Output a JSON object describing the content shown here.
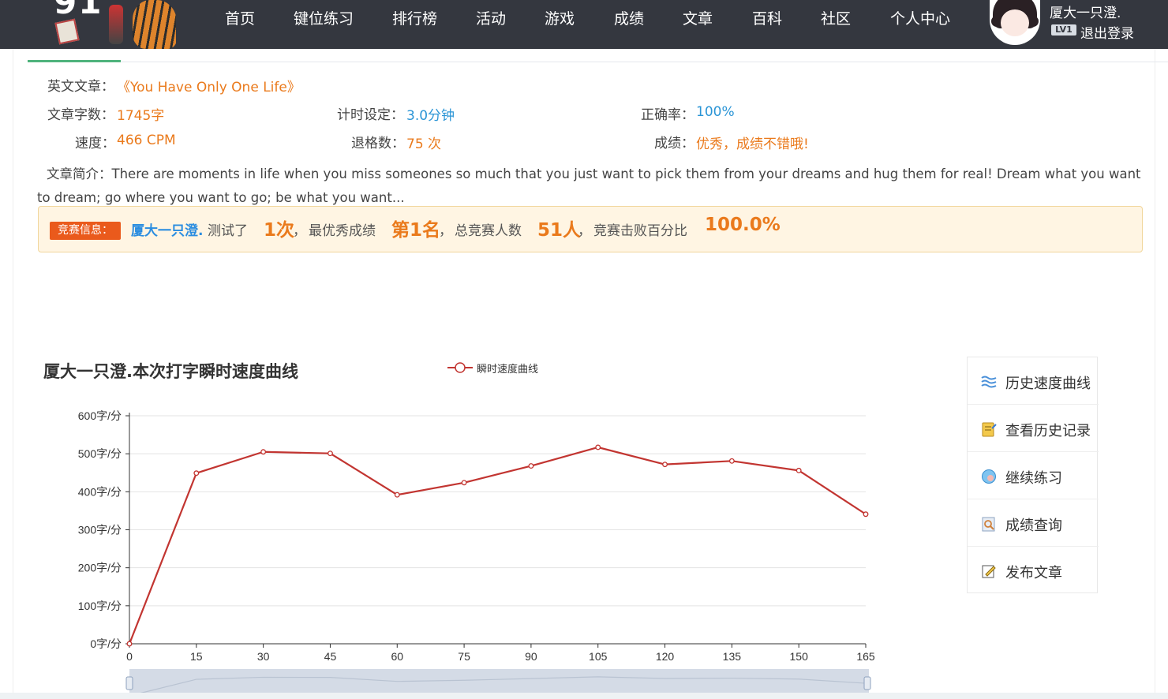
{
  "nav": {
    "links": [
      "首页",
      "键位练习",
      "排行榜",
      "活动",
      "游戏",
      "成绩",
      "文章",
      "百科",
      "社区",
      "个人中心"
    ],
    "user_name": "厦大一只澄.",
    "level": "LV1",
    "logout": "退出登录"
  },
  "result": {
    "article_label": "英文文章：",
    "article_title": "《You Have Only One Life》",
    "word_count_label": "文章字数：",
    "word_count": "1745字",
    "time_label": "计时设定：",
    "time_value": "3.0分钟",
    "accuracy_label": "正确率：",
    "accuracy": "100%",
    "speed_label": "速度：",
    "speed": "466 CPM",
    "backspace_label": "退格数：",
    "backspace": "75 次",
    "grade_label": "成绩：",
    "grade": "优秀，成绩不错哦!",
    "intro_label": "文章简介：",
    "intro": "There are moments in life when you miss someones so much that you just want to pick them from your dreams and hug them for real! Dream what you want to dream; go where you want to go; be what you want..."
  },
  "contest": {
    "tag": "竞赛信息：",
    "user": "厦大一只澄.",
    "tested": "测试了",
    "count": "1次",
    "sep1": "，",
    "best_label": "最优秀成绩",
    "rank": "第1名",
    "sep2": "，",
    "total_label": "总竞赛人数",
    "total": "51人",
    "sep3": "，",
    "beat_label": "竞赛击败百分比",
    "beat": "100.0%"
  },
  "chart_title": "厦大一只澄.本次打字瞬时速度曲线",
  "chart_data": {
    "type": "line",
    "title": "厦大一只澄.本次打字瞬时速度曲线",
    "x": [
      0,
      15,
      30,
      45,
      60,
      75,
      90,
      105,
      120,
      135,
      150,
      165
    ],
    "series": [
      {
        "name": "瞬时速度曲线",
        "values": [
          0,
          449,
          505,
          501,
          392,
          424,
          468,
          517,
          472,
          481,
          456,
          341
        ]
      }
    ],
    "ylim": [
      0,
      600
    ],
    "y_ticks": [
      "0字/分",
      "100字/分",
      "200字/分",
      "300字/分",
      "400字/分",
      "500字/分",
      "600字/分"
    ],
    "grid": true,
    "legend": "top",
    "color": "#c23531"
  },
  "side_menu": [
    {
      "label": "历史速度曲线",
      "icon": "speed-curve-icon"
    },
    {
      "label": "查看历史记录",
      "icon": "history-record-icon"
    },
    {
      "label": "继续练习",
      "icon": "continue-practice-icon"
    },
    {
      "label": "成绩查询",
      "icon": "score-query-icon"
    },
    {
      "label": "发布文章",
      "icon": "publish-article-icon"
    }
  ]
}
